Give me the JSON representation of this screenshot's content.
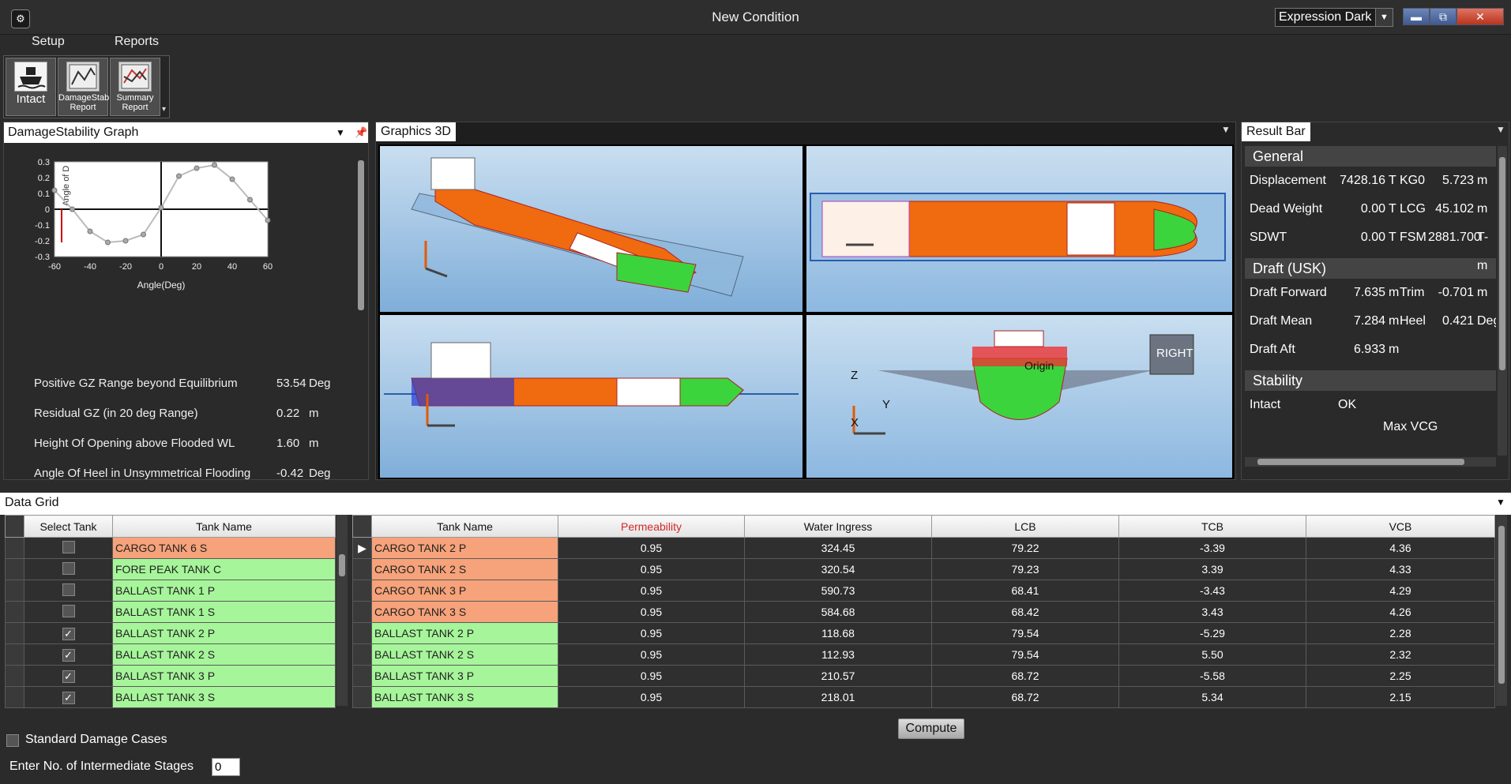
{
  "window": {
    "title": "New Condition",
    "theme": "Expression Dark",
    "minimize": "▬",
    "maximize": "⧉",
    "close": "✕"
  },
  "menu": {
    "setup": "Setup",
    "reports": "Reports"
  },
  "ribbon": {
    "intact": "Intact",
    "damagestab": [
      "DamageStab",
      "Report"
    ],
    "summary": [
      "Summary",
      "Report"
    ]
  },
  "graph_panel": {
    "title": "DamageStability Graph",
    "y_rotated_label": "Angle of D",
    "stats": [
      {
        "label": "Positive GZ Range beyond Equilibrium",
        "value": "53.54",
        "unit": "Deg"
      },
      {
        "label": "Residual GZ (in 20 deg Range)",
        "value": "0.22",
        "unit": "m"
      },
      {
        "label": "Height Of Opening above Flooded WL",
        "value": "1.60",
        "unit": "m"
      },
      {
        "label": "Angle Of Heel in Unsymmetrical Flooding",
        "value": "-0.42",
        "unit": "Deg"
      }
    ]
  },
  "chart_data": {
    "type": "line",
    "title": "",
    "xlabel": "Angle(Deg)",
    "ylabel": "Angle of D",
    "xlim": [
      -60,
      60
    ],
    "ylim": [
      -0.3,
      0.3
    ],
    "xticks": [
      -60,
      -40,
      -20,
      0,
      20,
      40,
      60
    ],
    "yticks": [
      0.3,
      0.2,
      0.1,
      0,
      -0.1,
      -0.2,
      -0.3
    ],
    "ytick_labels": [
      "0.3",
      "0.2",
      "0.1",
      "0",
      "-0.1",
      "-0.2",
      "-0.3"
    ],
    "series": [
      {
        "x": [
          -60,
          -50,
          -40,
          -30,
          -20,
          -10,
          0,
          10,
          20,
          30,
          40,
          50,
          60
        ],
        "values": [
          0.12,
          0.0,
          -0.14,
          -0.21,
          -0.2,
          -0.16,
          0.01,
          0.21,
          0.26,
          0.28,
          0.19,
          0.06,
          -0.07
        ]
      }
    ],
    "marker_x": -56,
    "marker_range": [
      -0.21,
      0.0
    ]
  },
  "graphics": {
    "title": "Graphics 3D",
    "labels": {
      "right": "RIGHT",
      "origin": "Origin",
      "z": "Z",
      "x": "X",
      "y": "Y"
    }
  },
  "result_bar": {
    "title": "Result Bar",
    "general": {
      "heading": "General",
      "rows": [
        {
          "label": "Displacement",
          "v1": "7428.16",
          "u1": "T",
          "label2": "KG0",
          "v2": "5.723",
          "u2": "m"
        },
        {
          "label": "Dead Weight",
          "v1": "0.00",
          "u1": "T",
          "label2": "LCG",
          "v2": "45.102",
          "u2": "m"
        },
        {
          "label": "SDWT",
          "v1": "0.00",
          "u1": "T",
          "label2": "FSM",
          "v2": "2881.700",
          "u2": "T-m"
        }
      ]
    },
    "draft": {
      "heading": "Draft (USK)",
      "rows": [
        {
          "label": "Draft Forward",
          "v1": "7.635",
          "u1": "m",
          "label2": "Trim",
          "v2": "-0.701",
          "u2": "m"
        },
        {
          "label": "Draft Mean",
          "v1": "7.284",
          "u1": "m",
          "label2": "Heel",
          "v2": "0.421",
          "u2": "Deg."
        },
        {
          "label": "Draft Aft",
          "v1": "6.933",
          "u1": "m",
          "label2": "",
          "v2": "",
          "u2": ""
        }
      ]
    },
    "stability": {
      "heading": "Stability",
      "intact_label": "Intact",
      "intact_value": "OK",
      "maxvcg": "Max VCG"
    }
  },
  "data_grid": {
    "title": "Data Grid",
    "left_headers": [
      "Select Tank",
      "Tank Name"
    ],
    "left_rows": [
      {
        "checked": false,
        "name": "CARGO TANK 6 S",
        "color": "red"
      },
      {
        "checked": false,
        "name": "FORE PEAK TANK C",
        "color": "green"
      },
      {
        "checked": false,
        "name": "BALLAST TANK 1 P",
        "color": "green"
      },
      {
        "checked": false,
        "name": "BALLAST TANK 1 S",
        "color": "green"
      },
      {
        "checked": true,
        "name": "BALLAST TANK 2 P",
        "color": "green"
      },
      {
        "checked": true,
        "name": "BALLAST TANK 2 S",
        "color": "green"
      },
      {
        "checked": true,
        "name": "BALLAST TANK 3 P",
        "color": "green"
      },
      {
        "checked": true,
        "name": "BALLAST TANK 3 S",
        "color": "green"
      }
    ],
    "right_headers": [
      "Tank Name",
      "Permeability",
      "Water Ingress",
      "LCB",
      "TCB",
      "VCB"
    ],
    "right_rows": [
      {
        "name": "CARGO TANK 2 P",
        "color": "red",
        "perm": "0.95",
        "ingress": "324.45",
        "lcb": "79.22",
        "tcb": "-3.39",
        "vcb": "4.36"
      },
      {
        "name": "CARGO TANK 2 S",
        "color": "red",
        "perm": "0.95",
        "ingress": "320.54",
        "lcb": "79.23",
        "tcb": "3.39",
        "vcb": "4.33"
      },
      {
        "name": "CARGO TANK 3 P",
        "color": "red",
        "perm": "0.95",
        "ingress": "590.73",
        "lcb": "68.41",
        "tcb": "-3.43",
        "vcb": "4.29"
      },
      {
        "name": "CARGO TANK 3 S",
        "color": "red",
        "perm": "0.95",
        "ingress": "584.68",
        "lcb": "68.42",
        "tcb": "3.43",
        "vcb": "4.26"
      },
      {
        "name": "BALLAST TANK 2 P",
        "color": "green",
        "perm": "0.95",
        "ingress": "118.68",
        "lcb": "79.54",
        "tcb": "-5.29",
        "vcb": "2.28"
      },
      {
        "name": "BALLAST TANK 2 S",
        "color": "green",
        "perm": "0.95",
        "ingress": "112.93",
        "lcb": "79.54",
        "tcb": "5.50",
        "vcb": "2.32"
      },
      {
        "name": "BALLAST TANK 3 P",
        "color": "green",
        "perm": "0.95",
        "ingress": "210.57",
        "lcb": "68.72",
        "tcb": "-5.58",
        "vcb": "2.25"
      },
      {
        "name": "BALLAST TANK 3 S",
        "color": "green",
        "perm": "0.95",
        "ingress": "218.01",
        "lcb": "68.72",
        "tcb": "5.34",
        "vcb": "2.15"
      }
    ],
    "compute": "Compute",
    "standard_damage": "Standard Damage Cases",
    "stages_label": "Enter No. of Intermediate Stages",
    "stages_value": "0"
  },
  "colors": {
    "accent_red": "#f6a27a",
    "accent_green": "#a6f59a",
    "permeability_header": "#d4282a"
  }
}
